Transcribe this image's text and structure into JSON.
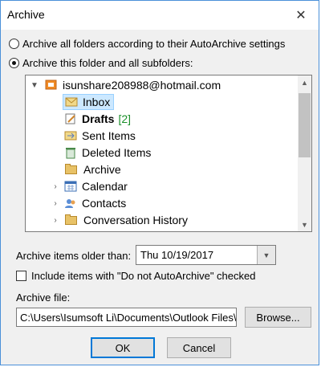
{
  "window": {
    "title": "Archive"
  },
  "options": {
    "archive_all_label": "Archive all folders according to their AutoArchive settings",
    "archive_this_label": "Archive this folder and all subfolders:"
  },
  "tree": {
    "account": "isunshare208988@hotmail.com",
    "items": [
      {
        "label": "Inbox"
      },
      {
        "label": "Drafts",
        "badge": "[2]"
      },
      {
        "label": "Sent Items"
      },
      {
        "label": "Deleted Items"
      },
      {
        "label": "Archive"
      },
      {
        "label": "Calendar"
      },
      {
        "label": "Contacts"
      },
      {
        "label": "Conversation History"
      }
    ]
  },
  "older_than": {
    "label": "Archive items older than:",
    "value": "Thu 10/19/2017"
  },
  "include_checkbox": {
    "label": "Include items with \"Do not AutoArchive\" checked"
  },
  "archive_file": {
    "label": "Archive file:",
    "value": "C:\\Users\\Isumsoft Li\\Documents\\Outlook Files\\a",
    "browse_label": "Browse..."
  },
  "buttons": {
    "ok_label": "OK",
    "cancel_label": "Cancel"
  },
  "colors": {
    "selection": "#cce8ff",
    "accent": "#0078d7",
    "badge": "#1a8f2a"
  }
}
